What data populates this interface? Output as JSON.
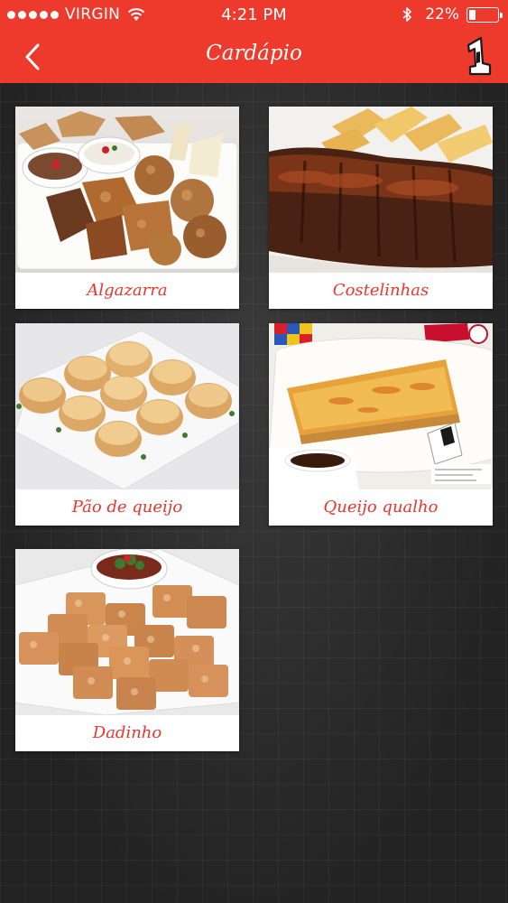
{
  "status_bar": {
    "carrier": "VIRGIN",
    "time": "4:21 PM",
    "battery": "22%",
    "battery_level": 0.22
  },
  "nav": {
    "title": "Cardápio",
    "back_icon": "chevron-left-icon",
    "logo_icon": "brand-number-one-logo"
  },
  "menu": {
    "items": [
      {
        "label": "Algazarra"
      },
      {
        "label": "Costelinhas"
      },
      {
        "label": "Pão de queijo"
      },
      {
        "label": "Queijo qualho"
      },
      {
        "label": "Dadinho"
      }
    ]
  },
  "colors": {
    "brand_red": "#ee3a2c",
    "label_red": "#e8362c",
    "background": "#2a2a2a"
  }
}
